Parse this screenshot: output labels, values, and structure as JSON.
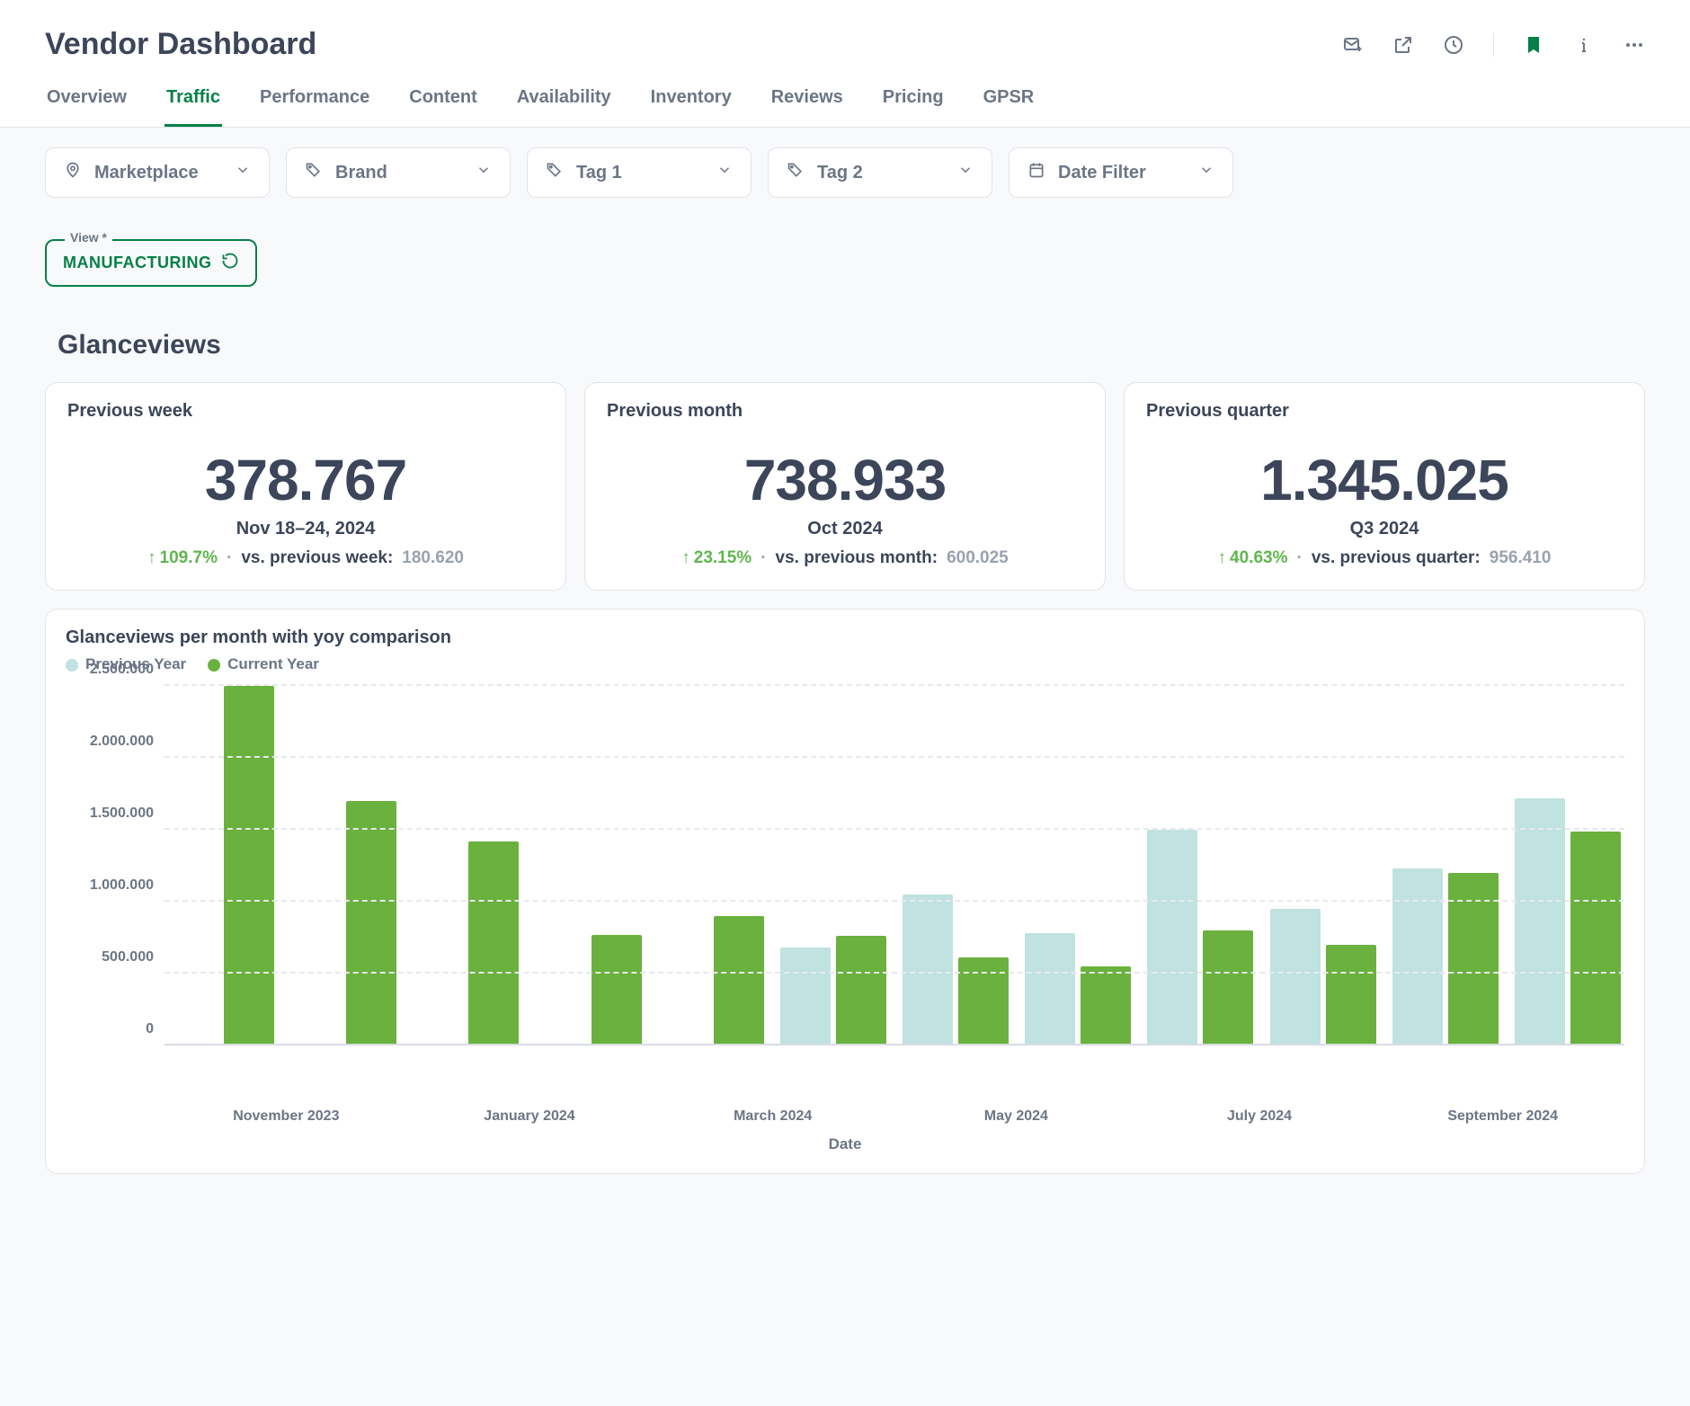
{
  "header": {
    "title": "Vendor Dashboard"
  },
  "tabs": [
    "Overview",
    "Traffic",
    "Performance",
    "Content",
    "Availability",
    "Inventory",
    "Reviews",
    "Pricing",
    "GPSR"
  ],
  "active_tab_index": 1,
  "filters": {
    "marketplace": "Marketplace",
    "brand": "Brand",
    "tag1": "Tag 1",
    "tag2": "Tag 2",
    "date": "Date Filter"
  },
  "view": {
    "legend": "View *",
    "value": "MANUFACTURING"
  },
  "section": {
    "title": "Glanceviews"
  },
  "cards": {
    "week": {
      "label": "Previous week",
      "value": "378.767",
      "period": "Nov 18–24, 2024",
      "delta": "109.7%",
      "compare": "vs. previous week:",
      "prev": "180.620"
    },
    "month": {
      "label": "Previous month",
      "value": "738.933",
      "period": "Oct 2024",
      "delta": "23.15%",
      "compare": "vs. previous month:",
      "prev": "600.025"
    },
    "quarter": {
      "label": "Previous quarter",
      "value": "1.345.025",
      "period": "Q3 2024",
      "delta": "40.63%",
      "compare": "vs. previous quarter:",
      "prev": "956.410"
    }
  },
  "chart": {
    "title": "Glanceviews per month with yoy comparison",
    "legend_prev": "Previous Year",
    "legend_curr": "Current Year",
    "xlabel": "Date",
    "ylabels": [
      "0",
      "500.000",
      "1.000.000",
      "1.500.000",
      "2.000.000",
      "2.500.000"
    ],
    "xlabels": [
      "November 2023",
      "January 2024",
      "March 2024",
      "May 2024",
      "July 2024",
      "September 2024"
    ]
  },
  "chart_data": {
    "type": "bar",
    "title": "Glanceviews per month with yoy comparison",
    "xlabel": "Date",
    "ylabel": "",
    "ylim": [
      0,
      2500000
    ],
    "categories": [
      "Nov 2023",
      "Dec 2023",
      "Jan 2024",
      "Feb 2024",
      "Mar 2024",
      "Apr 2024",
      "May 2024",
      "Jun 2024",
      "Jul 2024",
      "Aug 2024",
      "Sep 2024",
      "Oct 2024"
    ],
    "series": [
      {
        "name": "Previous Year",
        "values": [
          null,
          null,
          null,
          null,
          null,
          680000,
          1050000,
          780000,
          1500000,
          950000,
          1230000,
          1720000
        ]
      },
      {
        "name": "Current Year",
        "values": [
          2500000,
          1700000,
          1420000,
          770000,
          900000,
          760000,
          610000,
          550000,
          800000,
          700000,
          1200000,
          1490000
        ]
      }
    ],
    "x_tick_labels": [
      "November 2023",
      "January 2024",
      "March 2024",
      "May 2024",
      "July 2024",
      "September 2024"
    ]
  }
}
